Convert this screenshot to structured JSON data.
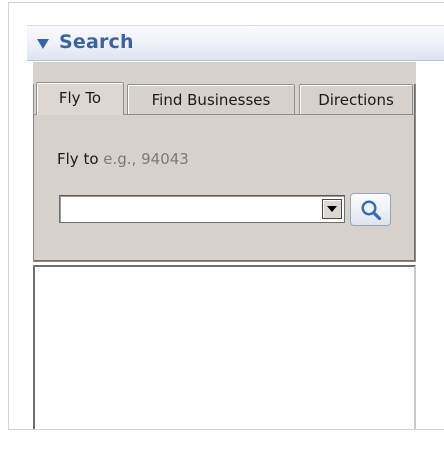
{
  "panel": {
    "title": "Search",
    "arrow_icon": "triangle-down-icon",
    "accent_color": "#3a62a6"
  },
  "tabs": [
    {
      "label": "Fly To",
      "active": true
    },
    {
      "label": "Find Businesses",
      "active": false
    },
    {
      "label": "Directions",
      "active": false
    }
  ],
  "fly_to": {
    "label": "Fly to",
    "hint": "e.g., 94043",
    "input_value": "",
    "search_icon": "magnifier-icon"
  },
  "results": {
    "items": []
  }
}
